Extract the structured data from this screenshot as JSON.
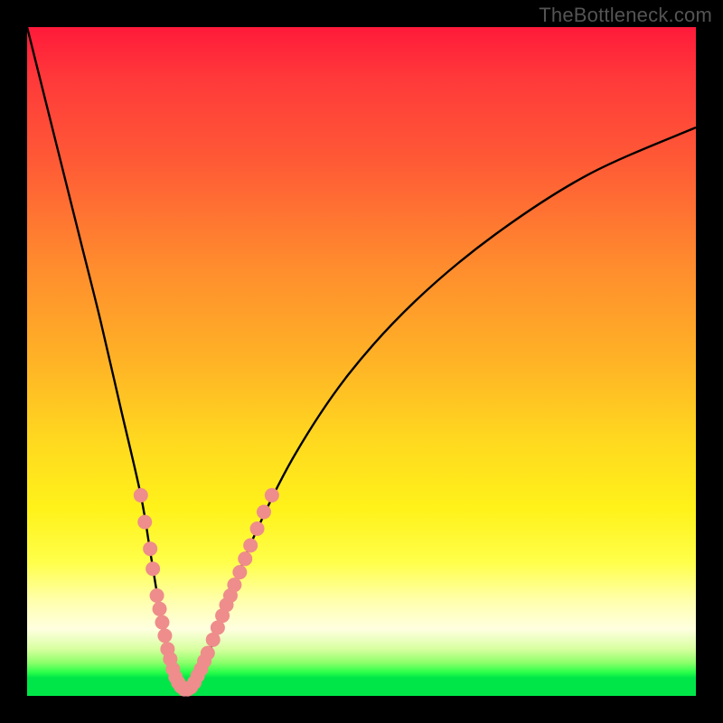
{
  "watermark": "TheBottleneck.com",
  "chart_data": {
    "type": "line",
    "title": "",
    "xlabel": "",
    "ylabel": "",
    "xlim": [
      0,
      100
    ],
    "ylim": [
      0,
      100
    ],
    "grid": false,
    "legend": false,
    "background_gradient": {
      "top": "#ff1a3a",
      "mid": "#ffd91f",
      "bottom_band": "#00e648"
    },
    "series": [
      {
        "name": "bottleneck-curve",
        "color": "#000000",
        "x": [
          0,
          2,
          5,
          8,
          11,
          14,
          17,
          18.5,
          20,
          21.5,
          23,
          24.5,
          27,
          30,
          34,
          40,
          48,
          58,
          70,
          84,
          100
        ],
        "y": [
          100,
          92,
          80,
          68,
          56,
          43,
          30,
          21,
          12,
          5,
          1,
          1,
          6,
          14,
          24,
          36,
          48,
          59,
          69,
          78,
          85
        ]
      }
    ],
    "markers": {
      "name": "highlighted-points",
      "color": "#ee8d8b",
      "radius": 8,
      "points": [
        {
          "x": 17.0,
          "y": 30
        },
        {
          "x": 17.6,
          "y": 26
        },
        {
          "x": 18.4,
          "y": 22
        },
        {
          "x": 18.8,
          "y": 19
        },
        {
          "x": 19.4,
          "y": 15
        },
        {
          "x": 19.8,
          "y": 13
        },
        {
          "x": 20.2,
          "y": 11
        },
        {
          "x": 20.6,
          "y": 9
        },
        {
          "x": 21.0,
          "y": 7
        },
        {
          "x": 21.4,
          "y": 5.5
        },
        {
          "x": 21.8,
          "y": 4
        },
        {
          "x": 22.2,
          "y": 2.8
        },
        {
          "x": 22.6,
          "y": 2
        },
        {
          "x": 23.0,
          "y": 1.4
        },
        {
          "x": 23.5,
          "y": 1
        },
        {
          "x": 24.0,
          "y": 1
        },
        {
          "x": 24.5,
          "y": 1.3
        },
        {
          "x": 25.0,
          "y": 2
        },
        {
          "x": 25.5,
          "y": 3
        },
        {
          "x": 26.0,
          "y": 4
        },
        {
          "x": 26.5,
          "y": 5.2
        },
        {
          "x": 27.0,
          "y": 6.4
        },
        {
          "x": 27.8,
          "y": 8.4
        },
        {
          "x": 28.5,
          "y": 10.2
        },
        {
          "x": 29.2,
          "y": 12
        },
        {
          "x": 29.8,
          "y": 13.6
        },
        {
          "x": 30.4,
          "y": 15
        },
        {
          "x": 31.0,
          "y": 16.6
        },
        {
          "x": 31.8,
          "y": 18.5
        },
        {
          "x": 32.6,
          "y": 20.5
        },
        {
          "x": 33.4,
          "y": 22.5
        },
        {
          "x": 34.4,
          "y": 25
        },
        {
          "x": 35.4,
          "y": 27.5
        },
        {
          "x": 36.6,
          "y": 30
        }
      ]
    }
  }
}
